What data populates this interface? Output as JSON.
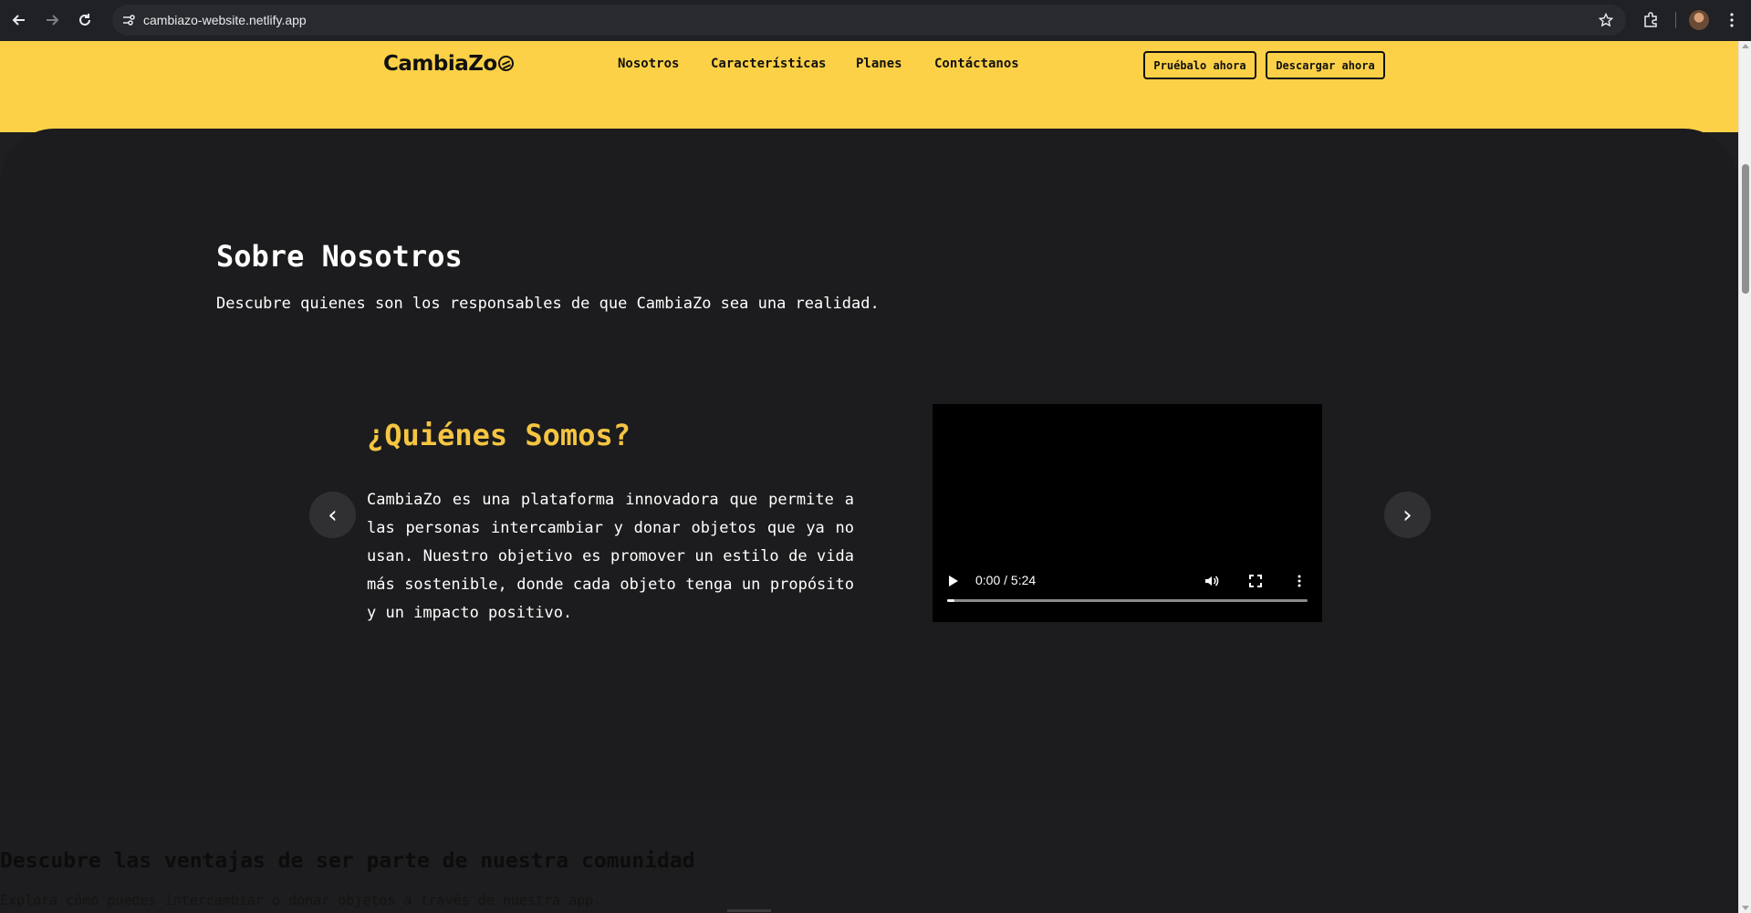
{
  "browser": {
    "url": "cambiazo-website.netlify.app"
  },
  "header": {
    "logo": "CambiaZo",
    "nav": [
      "Nosotros",
      "Características",
      "Planes",
      "Contáctanos"
    ],
    "try_button": "Pruébalo ahora",
    "download_button": "Descargar ahora"
  },
  "about": {
    "title": "Sobre Nosotros",
    "subtitle": "Descubre quienes son los responsables de que CambiaZo sea una realidad.",
    "slide": {
      "title": "¿Quiénes Somos?",
      "text": "CambiaZo es una plataforma innovadora que permite a las personas intercambiar y donar objetos que ya no usan. Nuestro objetivo es promover un estilo de vida más sostenible, donde cada objeto tenga un propósito y un impacto positivo."
    },
    "prev_arrow": "‹",
    "next_arrow": "›"
  },
  "video": {
    "time": "0:00 / 5:24",
    "progress": 0.02
  },
  "features": {
    "title": "Descubre las ventajas de ser parte de nuestra comunidad",
    "subtitle": "Explora cómo puedes intercambiar o donar objetos a través de nuestra app."
  },
  "colors": {
    "brand_yellow": "#fdd147",
    "accent_title": "#f5c542",
    "dark_bg": "#1c1c1e"
  }
}
